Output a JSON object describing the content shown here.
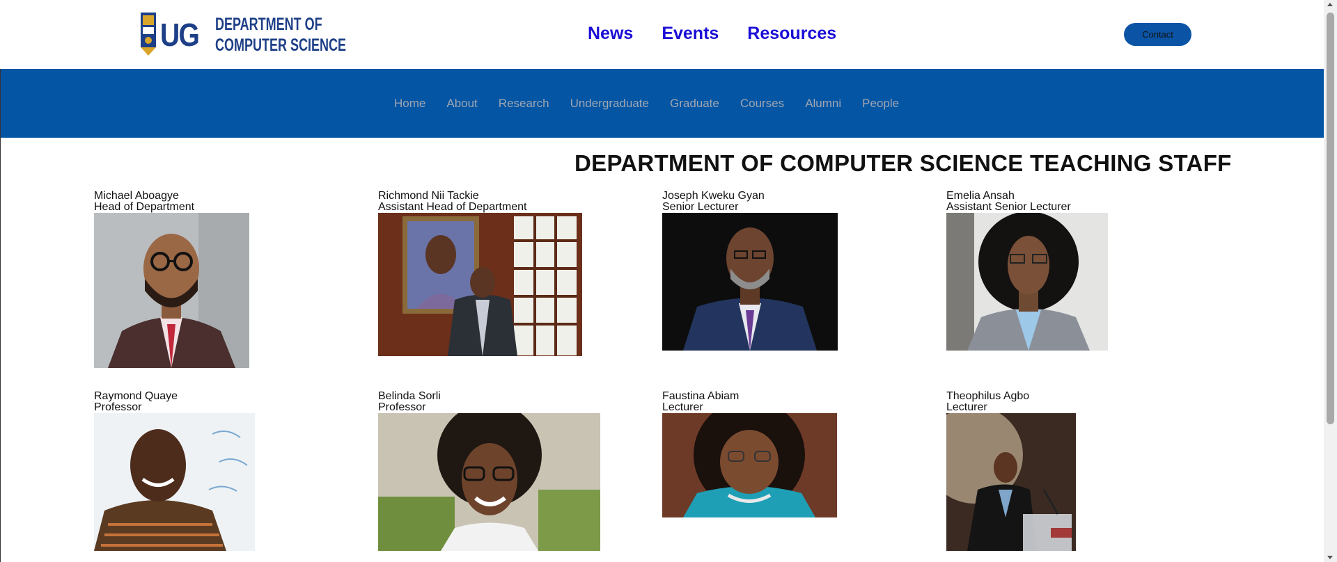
{
  "logo": {
    "short": "UG",
    "line1": "DEPARTMENT OF",
    "line2": "COMPUTER SCIENCE"
  },
  "top_nav": [
    "News",
    "Events",
    "Resources"
  ],
  "contact_label": "Contact",
  "sub_nav": [
    "Home",
    "About",
    "Research",
    "Undergraduate",
    "Graduate",
    "Courses",
    "Alumni",
    "People"
  ],
  "page_title": "DEPARTMENT OF COMPUTER SCIENCE TEACHING STAFF",
  "staff": [
    {
      "name": "Michael Aboagye",
      "role": "Head of Department"
    },
    {
      "name": "Richmond Nii Tackie",
      "role": "Assistant Head of Department"
    },
    {
      "name": "Joseph Kweku Gyan",
      "role": "Senior Lecturer"
    },
    {
      "name": "Emelia Ansah",
      "role": "Assistant Senior Lecturer"
    },
    {
      "name": "Raymond Quaye",
      "role": "Professor"
    },
    {
      "name": "Belinda Sorli",
      "role": "Professor"
    },
    {
      "name": "Faustina Abiam",
      "role": "Lecturer"
    },
    {
      "name": "Theophilus Agbo",
      "role": "Lecturer"
    }
  ],
  "colors": {
    "brand_blue": "#0455a3",
    "link_blue": "#1a0dd6",
    "logo_blue": "#1d3f87"
  }
}
